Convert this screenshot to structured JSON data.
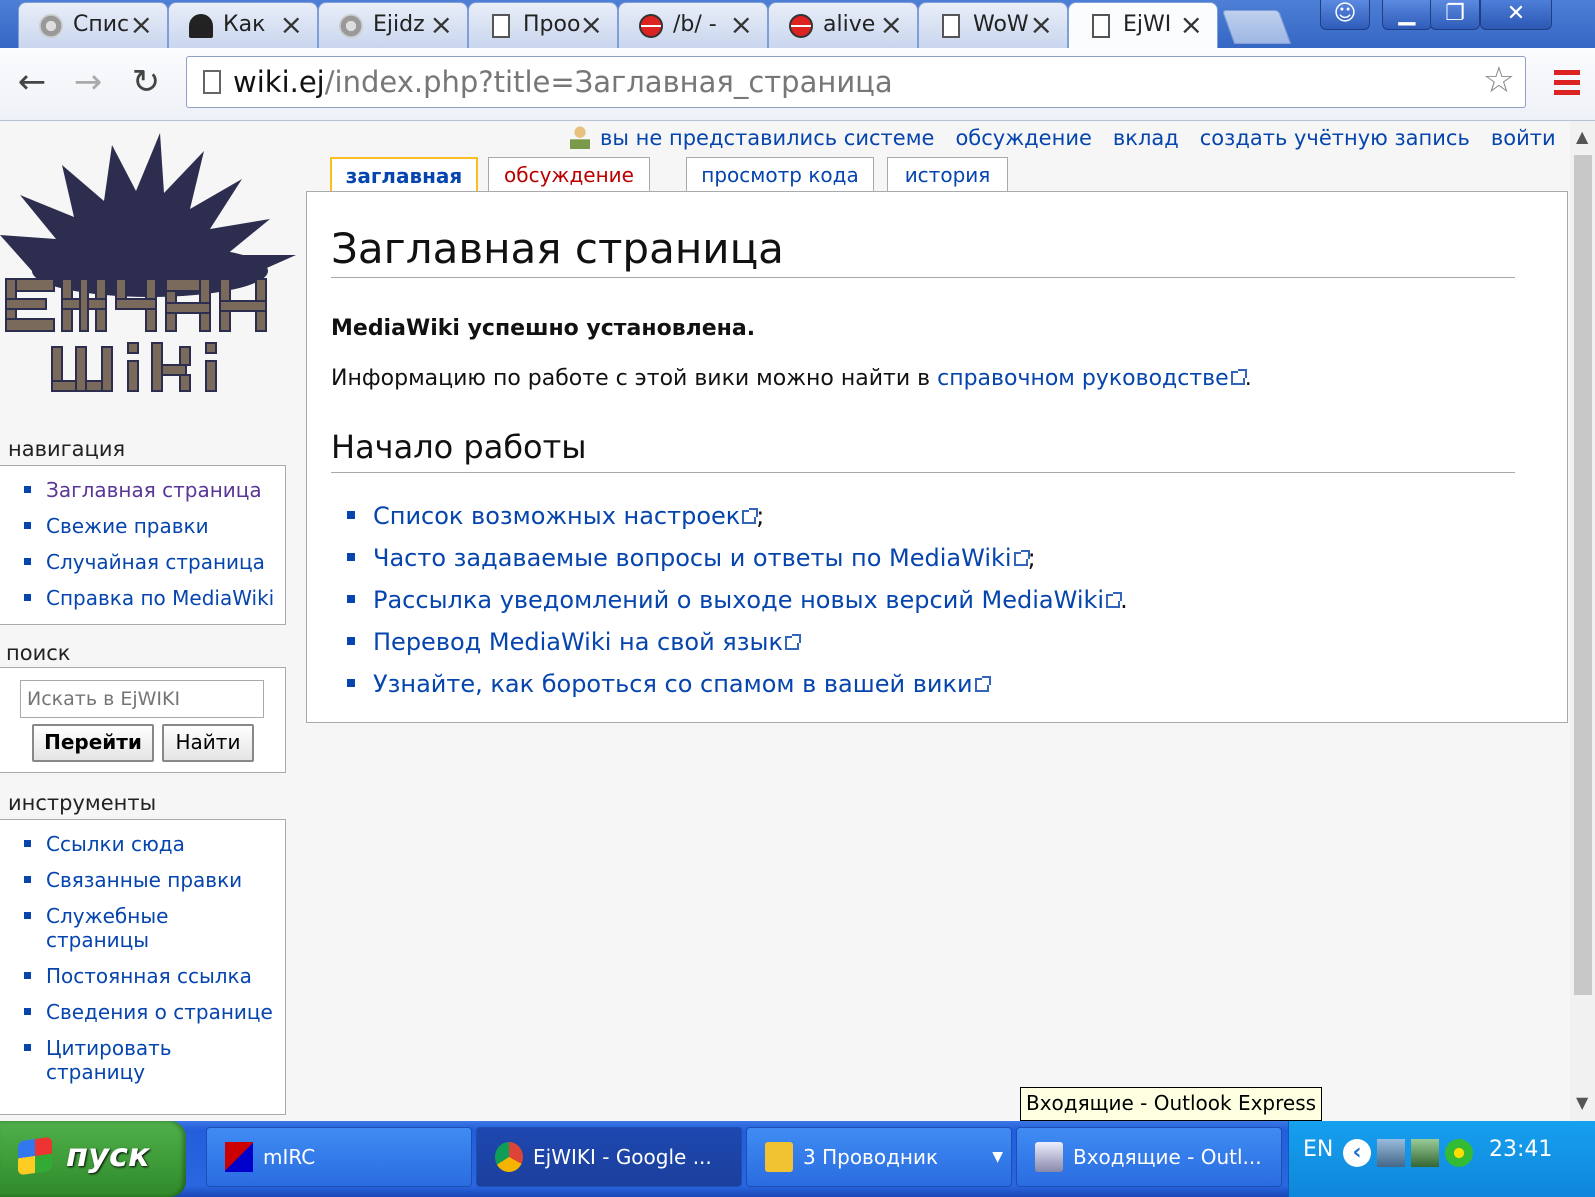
{
  "browser": {
    "tabs": [
      {
        "label": "Спис",
        "icon": "gear-icon"
      },
      {
        "label": "Как",
        "icon": "forum-icon"
      },
      {
        "label": "Ejidz",
        "icon": "gear-icon"
      },
      {
        "label": "Проо",
        "icon": "page-icon"
      },
      {
        "label": "/b/ -",
        "icon": "red-circle-icon"
      },
      {
        "label": "alive",
        "icon": "red-circle-icon"
      },
      {
        "label": "WoW",
        "icon": "page-icon"
      },
      {
        "label": "EjWI",
        "icon": "page-icon"
      }
    ],
    "url_host": "wiki.ej",
    "url_path": "/index.php?title=Заглавная_страница"
  },
  "personal": {
    "not_logged": "вы не представились системе",
    "talk": "обсуждение",
    "contrib": "вклад",
    "create": "создать учётную запись",
    "login": "войти"
  },
  "ptabs": {
    "main": "заглавная",
    "discussion": "обсуждение",
    "viewsource": "просмотр кода",
    "history": "история"
  },
  "content": {
    "title": "Заглавная страница",
    "installed": "MediaWiki успешно установлена.",
    "info_prefix": "Информацию по работе с этой вики можно найти в ",
    "info_link": "справочном руководстве",
    "info_suffix": ".",
    "start_heading": "Начало работы",
    "start_items": [
      {
        "link": "Список возможных настроек",
        "suffix": ";"
      },
      {
        "link": "Часто задаваемые вопросы и ответы по MediaWiki",
        "suffix": ";"
      },
      {
        "link": "Рассылка уведомлений о выходе новых версий MediaWiki",
        "suffix": "."
      },
      {
        "link": "Перевод MediaWiki на свой язык",
        "suffix": ""
      },
      {
        "link": "Узнайте, как бороться со спамом в вашей вики",
        "suffix": ""
      }
    ]
  },
  "sidebar": {
    "nav_heading": "навигация",
    "nav": [
      "Заглавная страница",
      "Свежие правки",
      "Случайная страница",
      "Справка по MediaWiki"
    ],
    "search_heading": "поиск",
    "search_placeholder": "Искать в EjWIKI",
    "go": "Перейти",
    "find": "Найти",
    "tools_heading": "инструменты",
    "tools": [
      "Ссылки сюда",
      "Связанные правки",
      "Служебные страницы",
      "Постоянная ссылка",
      "Сведения о странице",
      "Цитировать страницу"
    ]
  },
  "tooltip": "Входящие - Outlook Express",
  "taskbar": {
    "start": "пуск",
    "tasks": [
      "mIRC",
      "EjWIKI - Google ...",
      "3 Проводник",
      "Входящие - Outl..."
    ],
    "lang": "EN",
    "clock": "23:41"
  }
}
